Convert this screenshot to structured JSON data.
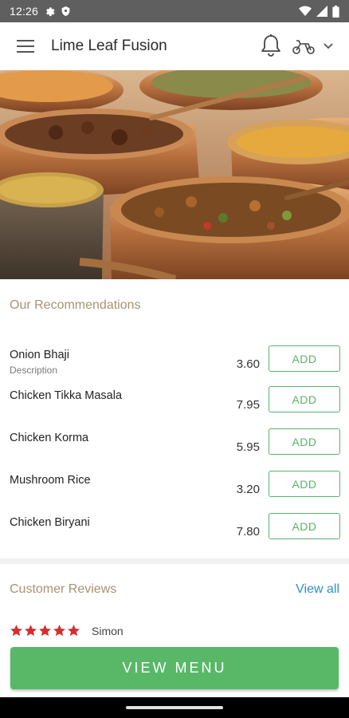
{
  "status_bar": {
    "time": "12:26",
    "left_icons": [
      "gear-icon",
      "shield-icon"
    ],
    "right_icons": [
      "wifi-icon",
      "signal-icon",
      "battery-icon"
    ]
  },
  "app_bar": {
    "title": "Lime Leaf Fusion",
    "icons": [
      "menu-icon",
      "bell-icon",
      "delivery-icon",
      "chevron-down-icon"
    ]
  },
  "recommendations": {
    "title": "Our Recommendations",
    "items": [
      {
        "name": "Onion Bhaji",
        "description": "Description",
        "price": "3.60",
        "button": "ADD"
      },
      {
        "name": "Chicken Tikka Masala",
        "description": "",
        "price": "7.95",
        "button": "ADD"
      },
      {
        "name": "Chicken Korma",
        "description": "",
        "price": "5.95",
        "button": "ADD"
      },
      {
        "name": "Mushroom Rice",
        "description": "",
        "price": "3.20",
        "button": "ADD"
      },
      {
        "name": "Chicken Biryani",
        "description": "",
        "price": "7.80",
        "button": "ADD"
      }
    ]
  },
  "reviews": {
    "title": "Customer Reviews",
    "view_all": "View all",
    "first_review": {
      "rating": 5,
      "reviewer": "Simon"
    }
  },
  "cta": {
    "label": "VIEW MENU"
  },
  "colors": {
    "accent_green": "#58b868",
    "link_blue": "#2f8fc9",
    "section_title": "#a89372",
    "star_red": "#d32f2f"
  }
}
